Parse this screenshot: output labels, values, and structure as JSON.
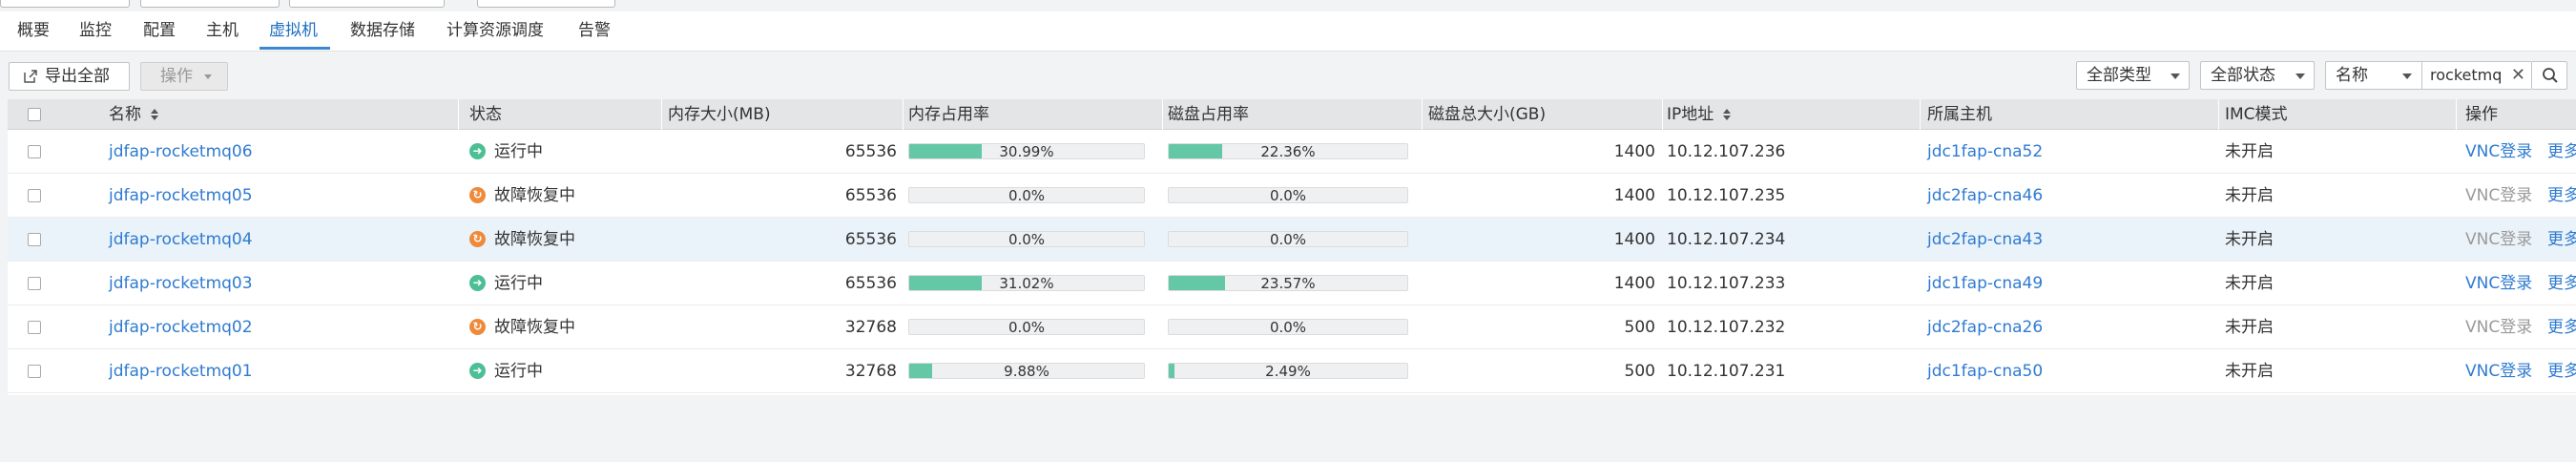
{
  "tabs": [
    {
      "label": "概要"
    },
    {
      "label": "监控"
    },
    {
      "label": "配置"
    },
    {
      "label": "主机"
    },
    {
      "label": "虚拟机",
      "active": true
    },
    {
      "label": "数据存储"
    },
    {
      "label": "计算资源调度"
    },
    {
      "label": "告警"
    }
  ],
  "toolbar": {
    "export_label": "导出全部",
    "actions_label": "操作",
    "type_filter": "全部类型",
    "status_filter": "全部状态",
    "search_field": "名称",
    "search_value": "rocketmq"
  },
  "columns": {
    "name": "名称",
    "status": "状态",
    "mem_size": "内存大小(MB)",
    "mem_usage": "内存占用率",
    "disk_usage": "磁盘占用率",
    "disk_total": "磁盘总大小(GB)",
    "ip": "IP地址",
    "host": "所属主机",
    "imc": "IMC模式",
    "ops": "操作"
  },
  "rows": [
    {
      "name": "jdfap-rocketmq06",
      "status": "运行中",
      "mem": "65536",
      "mem_pct": 30.99,
      "mem_label": "30.99%",
      "disk_pct": 22.36,
      "disk_label": "22.36%",
      "disk_total": "1400",
      "ip": "10.12.107.236",
      "host": "jdc1fap-cna52",
      "imc": "未开启",
      "vnc": "VNC登录",
      "more": "更多"
    },
    {
      "name": "jdfap-rocketmq05",
      "status": "故障恢复中",
      "mem": "65536",
      "mem_pct": 0,
      "mem_label": "0.0%",
      "disk_pct": 0,
      "disk_label": "0.0%",
      "disk_total": "1400",
      "ip": "10.12.107.235",
      "host": "jdc2fap-cna46",
      "imc": "未开启",
      "vnc": "VNC登录",
      "more": "更多"
    },
    {
      "name": "jdfap-rocketmq04",
      "status": "故障恢复中",
      "mem": "65536",
      "mem_pct": 0,
      "mem_label": "0.0%",
      "disk_pct": 0,
      "disk_label": "0.0%",
      "disk_total": "1400",
      "ip": "10.12.107.234",
      "host": "jdc2fap-cna43",
      "imc": "未开启",
      "vnc": "VNC登录",
      "more": "更多"
    },
    {
      "name": "jdfap-rocketmq03",
      "status": "运行中",
      "mem": "65536",
      "mem_pct": 31.02,
      "mem_label": "31.02%",
      "disk_pct": 23.57,
      "disk_label": "23.57%",
      "disk_total": "1400",
      "ip": "10.12.107.233",
      "host": "jdc1fap-cna49",
      "imc": "未开启",
      "vnc": "VNC登录",
      "more": "更多"
    },
    {
      "name": "jdfap-rocketmq02",
      "status": "故障恢复中",
      "mem": "32768",
      "mem_pct": 0,
      "mem_label": "0.0%",
      "disk_pct": 0,
      "disk_label": "0.0%",
      "disk_total": "500",
      "ip": "10.12.107.232",
      "host": "jdc2fap-cna26",
      "imc": "未开启",
      "vnc": "VNC登录",
      "more": "更多"
    },
    {
      "name": "jdfap-rocketmq01",
      "status": "运行中",
      "mem": "32768",
      "mem_pct": 9.88,
      "mem_label": "9.88%",
      "disk_pct": 2.49,
      "disk_label": "2.49%",
      "disk_total": "500",
      "ip": "10.12.107.231",
      "host": "jdc1fap-cna50",
      "imc": "未开启",
      "vnc": "VNC登录",
      "more": "更多"
    }
  ],
  "status_styles": {
    "running": {
      "color": "#4cbf95",
      "icon": "running-arrow-icon"
    },
    "recovering": {
      "color": "#ef8a3b",
      "icon": "recovering-icon"
    }
  },
  "colors": {
    "accent": "#2f7bd0",
    "bar_fill": "#64c8a6"
  }
}
